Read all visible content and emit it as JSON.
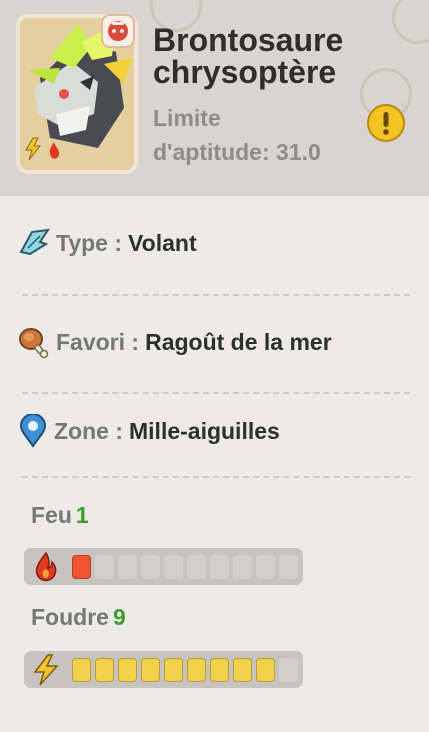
{
  "header": {
    "name_line1": "Brontosaure",
    "name_line2": "chrysoptère",
    "limit_line1": "Limite",
    "limit_line2": "d'aptitude: 31.0"
  },
  "attributes": [
    {
      "icon": "wing-icon",
      "label": "Type :",
      "value": "Volant"
    },
    {
      "icon": "meat-icon",
      "label": "Favori :",
      "value": "Ragoût de la mer"
    },
    {
      "icon": "location-pin-icon",
      "label": "Zone :",
      "value": "Mille-aiguilles"
    }
  ],
  "elements": [
    {
      "icon": "fire-icon",
      "label": "Feu",
      "level": 1,
      "max": 10,
      "color": "#f0532f"
    },
    {
      "icon": "lightning-icon",
      "label": "Foudre",
      "level": 9,
      "max": 10,
      "color": "#f2d24a"
    }
  ],
  "colors": {
    "level_number": "#3f9d2b",
    "alert": "#f2c525"
  }
}
